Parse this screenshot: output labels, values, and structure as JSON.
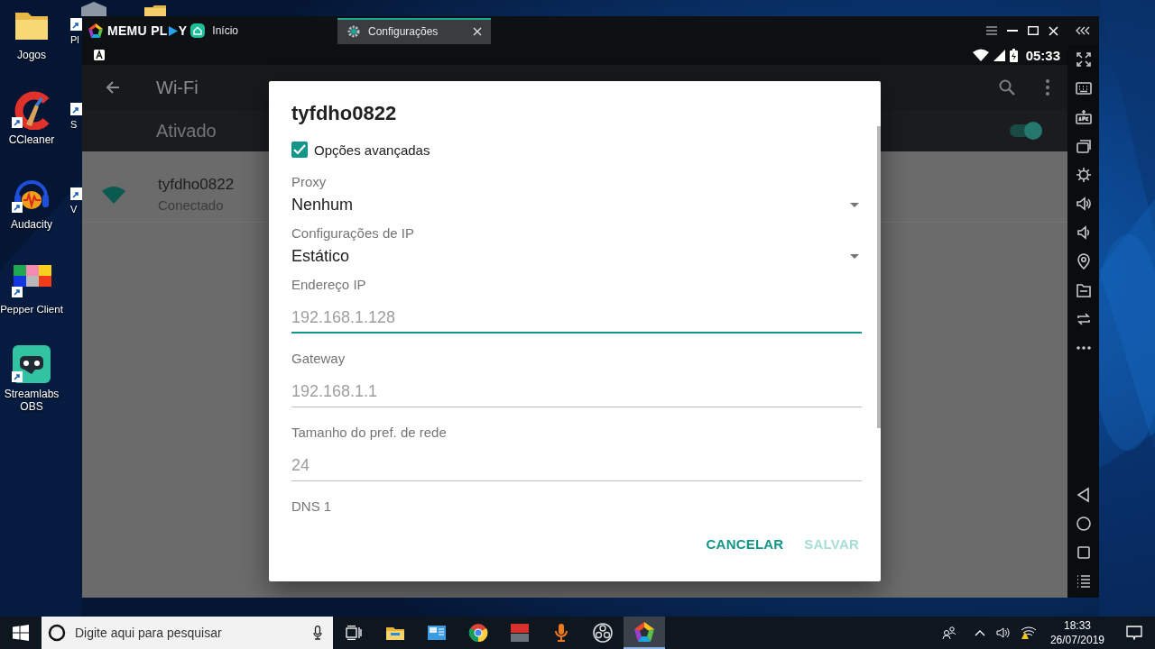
{
  "desktop": {
    "icons": [
      {
        "label": "Jogos",
        "kind": "folder",
        "shortcut": false
      },
      {
        "label": "CCleaner",
        "kind": "ccleaner",
        "shortcut": true
      },
      {
        "label": "Audacity",
        "kind": "audacity",
        "shortcut": true
      },
      {
        "label": "Pepper Client",
        "kind": "pepper",
        "shortcut": true
      },
      {
        "label": "Streamlabs OBS",
        "kind": "streamlabs",
        "shortcut": true
      }
    ],
    "partial_icons": [
      {
        "label": "Pl"
      },
      {
        "label": "S"
      },
      {
        "label": "V"
      }
    ]
  },
  "emulator": {
    "brand": {
      "before": "MEMU PL",
      "after": "Y"
    },
    "tabs": [
      {
        "label": "Início",
        "kind": "home",
        "selected": false,
        "closable": false
      },
      {
        "label": "Configurações",
        "kind": "gear",
        "selected": true,
        "closable": true
      }
    ],
    "status_bar": {
      "time": "05:33"
    },
    "toolbar": {
      "title": "Wi-Fi"
    },
    "master_switch": {
      "label": "Ativado",
      "on": true
    },
    "networks": [
      {
        "name": "tyfdho0822",
        "status": "Conectado"
      }
    ]
  },
  "dialog": {
    "title": "tyfdho0822",
    "advanced": {
      "label": "Opções avançadas",
      "checked": true
    },
    "dropdowns": [
      {
        "label": "Proxy",
        "value": "Nenhum"
      },
      {
        "label": "Configurações de IP",
        "value": "Estático"
      }
    ],
    "fields": [
      {
        "label": "Endereço IP",
        "placeholder": "192.168.1.128",
        "focused": true
      },
      {
        "label": "Gateway",
        "placeholder": "192.168.1.1",
        "focused": false
      },
      {
        "label": "Tamanho do pref. de rede",
        "placeholder": "24",
        "focused": false
      }
    ],
    "trailing_label": "DNS 1",
    "buttons": [
      {
        "label": "CANCELAR",
        "disabled": false
      },
      {
        "label": "SALVAR",
        "disabled": true
      }
    ]
  },
  "taskbar": {
    "search": {
      "placeholder": "Digite aqui para pesquisar"
    },
    "apps": [
      {
        "kind": "explorer",
        "selected": false
      },
      {
        "kind": "contacts",
        "selected": false
      },
      {
        "kind": "chrome",
        "selected": false
      },
      {
        "kind": "voicemeeter",
        "selected": false
      },
      {
        "kind": "recorder",
        "selected": false
      },
      {
        "kind": "obs",
        "selected": false
      },
      {
        "kind": "memu",
        "selected": true
      }
    ],
    "clock": {
      "time": "18:33",
      "date": "26/07/2019"
    }
  }
}
